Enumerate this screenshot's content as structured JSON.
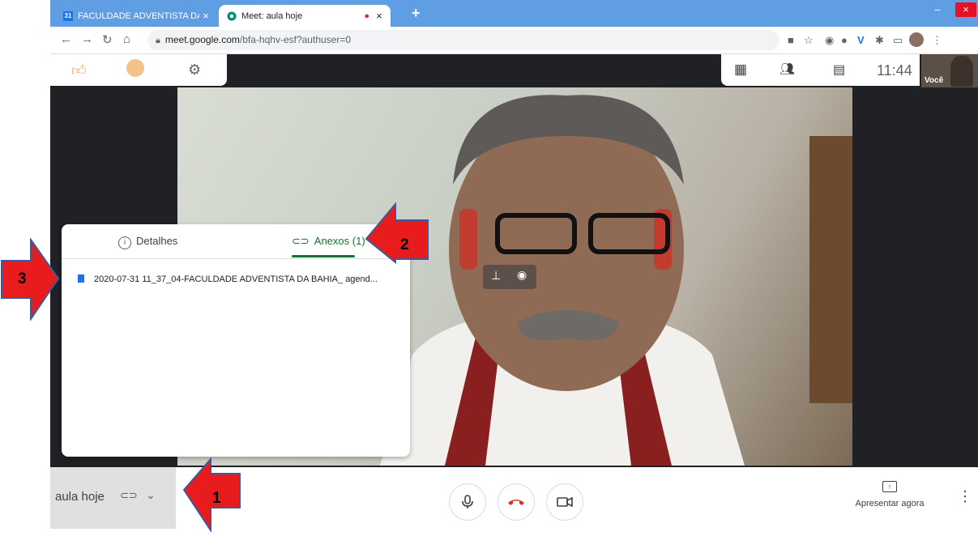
{
  "browser": {
    "tabs": [
      {
        "label": "FACULDADE ADVENTISTA DA BA",
        "favicon": "calendar-31",
        "favicon_text": "31",
        "close": "×"
      },
      {
        "label": "Meet: aula hoje",
        "favicon": "meet-icon",
        "recording": "●",
        "close": "×"
      }
    ],
    "new_tab": "+",
    "window_controls": {
      "minimize": "–",
      "restore": "▭",
      "close": "×"
    },
    "address": {
      "domain": "meet.google.com",
      "path": "/bfa-hqhv-esf?authuser=0"
    }
  },
  "meet": {
    "clock": "11:44",
    "self_label": "Você",
    "meeting_name": "aula hoje",
    "present_label": "Apresentar agora"
  },
  "panel": {
    "tab_details": "Detalhes",
    "tab_attachments": "Anexos (1)",
    "file_name": "2020-07-31 11_37_04-FACULDADE ADVENTISTA DA BAHIA_ agend..."
  },
  "annotations": {
    "a1": "1",
    "a2": "2",
    "a3": "3"
  },
  "colors": {
    "chrome_blue": "#5f9ee3",
    "meet_dark": "#202124",
    "accent_green": "#137333",
    "file_blue": "#1a73e8",
    "hangup_red": "#d93025",
    "arrow_red": "#e81c1c"
  }
}
